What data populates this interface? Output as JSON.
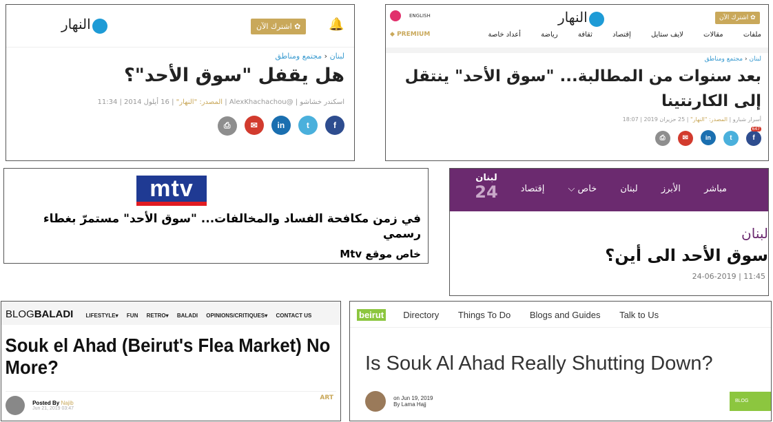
{
  "p1": {
    "logo": "النهار",
    "subscribe": "اشترك الآن",
    "breadcrumb": [
      "لبنان",
      "مجتمع ومناطق"
    ],
    "title": "هل يقفل \"سوق الأحد\"؟",
    "meta": {
      "author": "اسكندر خشاشو",
      "handle": "@AlexKhachachou",
      "source": "المصدر: \"النهار\"",
      "date": "16 أيلول 2014 | 11:34"
    },
    "share": [
      "f",
      "t",
      "in",
      "✉",
      "⎙"
    ]
  },
  "p2": {
    "logo": "النهار",
    "subscribe": "اشترك الآن",
    "english": "ENGLISH",
    "premium": "PREMIUM",
    "nav": [
      "ملفات",
      "مقالات",
      "لايف ستايل",
      "إقتصاد",
      "ثقافة",
      "رياضة",
      "أعداد خاصة"
    ],
    "breadcrumb": [
      "لبنان",
      "مجتمع ومناطق"
    ],
    "title": "بعد سنوات من المطالبة... \"سوق الأحد\" ينتقل إلى الكارنتينا",
    "meta": {
      "author": "أسرار شبارو",
      "source": "المصدر: \"النهار\"",
      "date": "25 حزيران 2019 | 18:07"
    },
    "share_count": "647"
  },
  "p3": {
    "logo": "mtv",
    "title": "في زمن مكافحة الفساد والمخالفات... \"سوق الأحد\" مستمرّ بغطاء رسمي",
    "byline": "خاص موقع Mtv"
  },
  "p4": {
    "logo_top": "لبنان",
    "logo_bottom": "24",
    "nav": [
      "مباشر",
      "الأبرز",
      "لبنان",
      "خاص",
      "إقتصاد"
    ],
    "category": "لبنان",
    "title": "سوق الأحد الى أين؟",
    "date": "11:45 | 24-06-2019"
  },
  "p5": {
    "logo_a": "BLOG",
    "logo_b": "BALADI",
    "nav": [
      "LIFESTYLE",
      "FUN",
      "RETRO",
      "BALADI",
      "OPINIONS/CRITIQUES",
      "CONTACT US"
    ],
    "title": "Souk el Ahad (Beirut's Flea Market) No More?",
    "posted_by": "Posted By",
    "author": "Najib",
    "date": "Jun 21, 2019 03:47",
    "tag": "ART"
  },
  "p6": {
    "logo": "beirut",
    "nav": [
      "Directory",
      "Things To Do",
      "Blogs and Guides",
      "Talk to Us"
    ],
    "title": "Is Souk Al Ahad Really Shutting Down?",
    "date": "on Jun 19, 2019",
    "author": "By Lama Hajj",
    "tag": "BLOG"
  },
  "colors": {
    "nahar_blue": "#1e9bd6",
    "gold": "#c9a85a",
    "mtv_blue": "#1f3a93",
    "mtv_red": "#e11b22",
    "lebanon24_purple": "#6b2a6f",
    "beirut_green": "#8cc63f"
  }
}
